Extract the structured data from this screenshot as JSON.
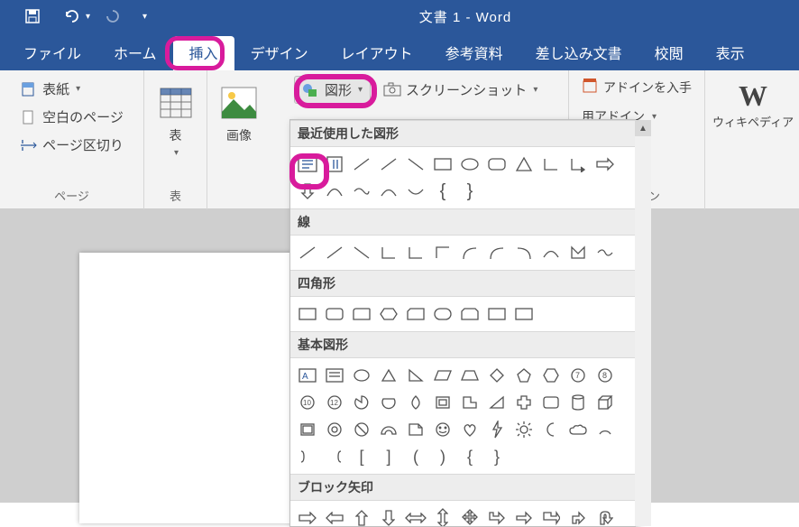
{
  "title": "文書 1 - Word",
  "tabs": {
    "file": "ファイル",
    "home": "ホーム",
    "insert": "挿入",
    "design": "デザイン",
    "layout": "レイアウト",
    "ref": "参考資料",
    "mail": "差し込み文書",
    "review": "校閲",
    "view": "表示"
  },
  "ribbon": {
    "cover": "表紙",
    "blank": "空白のページ",
    "break": "ページ区切り",
    "pagesLabel": "ページ",
    "table": "表",
    "tableLabel": "表",
    "image": "画像",
    "shapes": "図形",
    "screenshot": "スクリーンショット",
    "getAddins": "アドインを入手",
    "myAddins": "用アドイン",
    "addinsLabel": "アドイン",
    "wikipedia": "ウィキペディア"
  },
  "shapesPanel": {
    "recent": "最近使用した図形",
    "lines": "線",
    "rect": "四角形",
    "basic": "基本図形",
    "block": "ブロック矢印"
  }
}
